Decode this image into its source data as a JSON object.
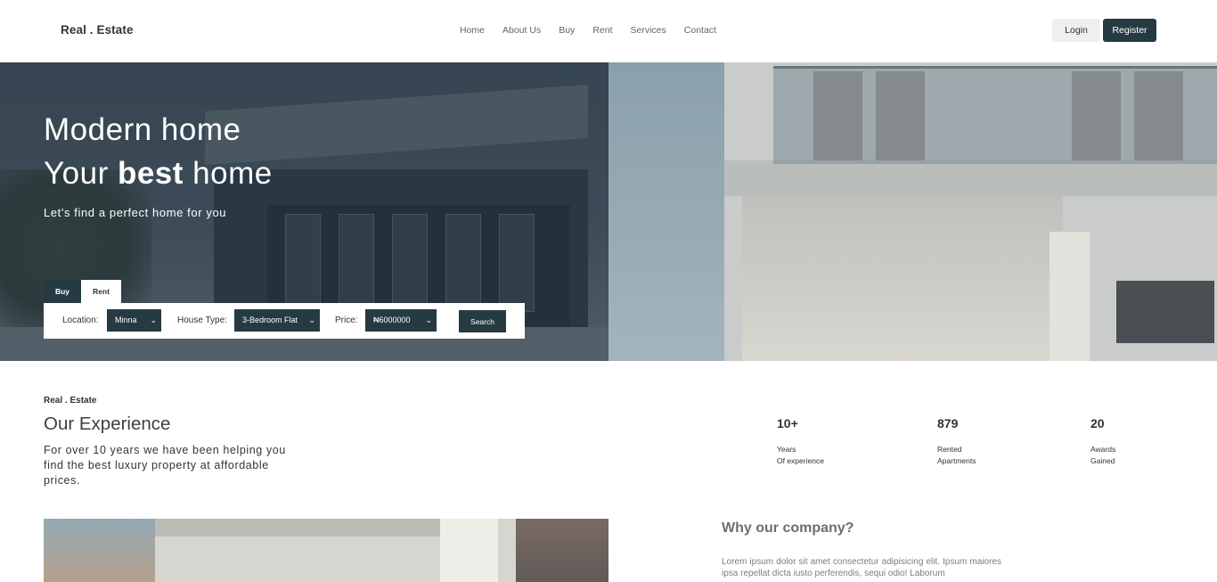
{
  "header": {
    "logo": "Real . Estate",
    "nav": [
      "Home",
      "About Us",
      "Buy",
      "Rent",
      "Services",
      "Contact"
    ],
    "login": "Login",
    "register": "Register"
  },
  "hero": {
    "title_line1": "Modern home",
    "title_line2_prefix": "Your ",
    "title_line2_bold": "best",
    "title_line2_suffix": " home",
    "subtitle": "Let's find a perfect home for you",
    "tabs": [
      "Buy",
      "Rent"
    ],
    "search": {
      "location_label": "Location:",
      "location_value": "Minna",
      "house_type_label": "House Type:",
      "house_type_value": "3-Bedroom Flat",
      "price_label": "Price:",
      "price_value": "₦6000000",
      "button": "Search"
    }
  },
  "experience": {
    "brand": "Real . Estate",
    "title": "Our Experience",
    "text": "For over 10 years we have been helping you find the best luxury property at affordable prices.",
    "stats": [
      {
        "number": "10+",
        "line1": "Years",
        "line2": "Of experience"
      },
      {
        "number": "879",
        "line1": "Rented",
        "line2": "Apartments"
      },
      {
        "number": "20",
        "line1": "Awards",
        "line2": "Gained"
      }
    ]
  },
  "why": {
    "title": "Why our company?",
    "text": "Lorem ipsum dolor sit amet consectetur adipisicing elit. Ipsum maiores ipsa repellat dicta iusto perferendis, sequi odio! Laborum"
  },
  "colors": {
    "accent": "#263a42",
    "light_button": "#eeeff0"
  }
}
